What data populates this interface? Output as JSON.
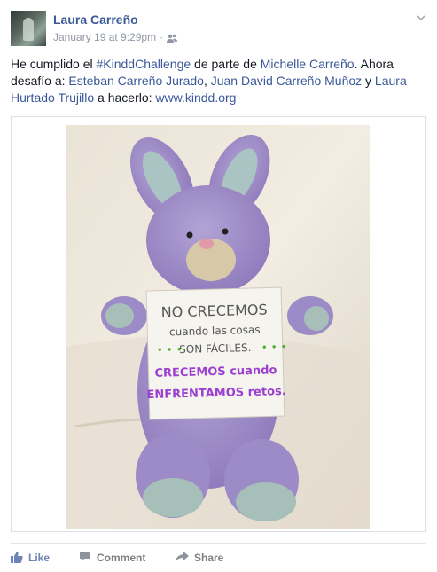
{
  "post": {
    "author": "Laura Carreño",
    "timestamp": "January 19 at 9:29pm",
    "separator": "·",
    "audience_icon": "friends-icon",
    "text": {
      "p1": "He cumplido el ",
      "hashtag": "#KinddChallenge",
      "p2": " de parte de ",
      "mention1": "Michelle Carreño",
      "p3": ". Ahora desafío a: ",
      "mention2": "Esteban Carreño Jurado",
      "p4": ", ",
      "mention3": "Juan David Carreño Muñoz",
      "p5": " y ",
      "mention4": "Laura Hurtado Trujillo",
      "p6": " a hacerlo: ",
      "url": "www.kindd.org"
    },
    "sign_lines": [
      "NO CRECEMOS",
      "cuando las cosas",
      "SON FÁCILES.",
      "CRECEMOS cuando",
      "ENFRENTAMOS retos."
    ]
  },
  "actions": {
    "like": "Like",
    "comment": "Comment",
    "share": "Share"
  },
  "colors": {
    "link": "#3b5998",
    "like": "#6d84b4",
    "muted": "#9197a3",
    "bunny": "#9a87c4",
    "sign_purple": "#9b3fd0"
  }
}
